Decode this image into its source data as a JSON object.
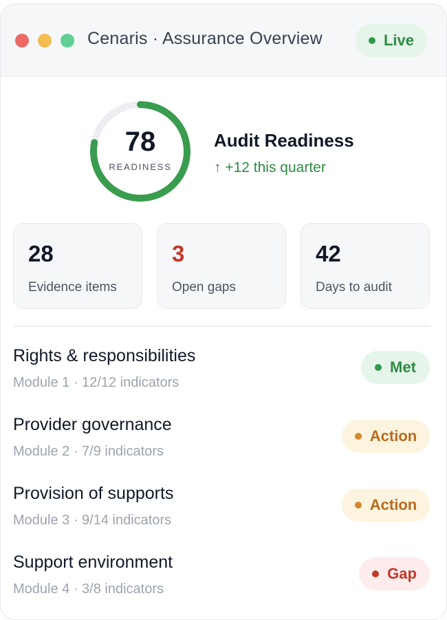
{
  "window": {
    "title": "Cenaris · Assurance Overview",
    "status": "Live"
  },
  "readiness": {
    "score": "78",
    "score_value": 78,
    "score_max": 100,
    "label": "READINESS",
    "title": "Audit Readiness",
    "change": "↑ +12 this quarter"
  },
  "stats": [
    {
      "value": "28",
      "label": "Evidence items"
    },
    {
      "value": "3",
      "label": "Open gaps"
    },
    {
      "value": "42",
      "label": "Days to audit"
    }
  ],
  "modules": [
    {
      "title": "Rights & responsibilities",
      "subtitle": "Module 1 · 12/12 indicators",
      "status": "Met"
    },
    {
      "title": "Provider governance",
      "subtitle": "Module 2 · 7/9 indicators",
      "status": "Action"
    },
    {
      "title": "Provision of supports",
      "subtitle": "Module 3 · 9/14 indicators",
      "status": "Action"
    },
    {
      "title": "Support environment",
      "subtitle": "Module 4 · 3/8 indicators",
      "status": "Gap"
    }
  ],
  "colors": {
    "ring_progress": "#3a9c4e",
    "ring_track": "#eceef1",
    "met": "#2f8a44",
    "action": "#b86a1e",
    "gap": "#c0392b"
  }
}
